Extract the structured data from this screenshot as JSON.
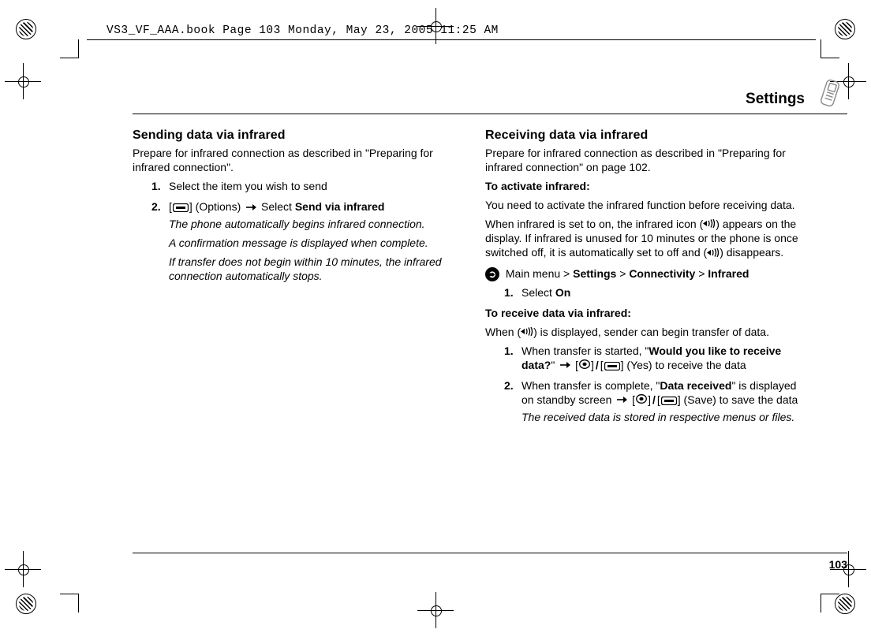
{
  "slug": "VS3_VF_AAA.book  Page 103  Monday, May 23, 2005  11:25 AM",
  "running_head": "Settings",
  "page_number": "103",
  "left": {
    "heading": "Sending data via infrared",
    "intro": "Prepare for infrared connection as described in \"Preparing for infrared connection\".",
    "step1_num": "1.",
    "step1": "Select the item you wish to send",
    "step2_num": "2.",
    "step2_pre": "[",
    "step2_mid1": "] (Options) ",
    "step2_mid2": " Select ",
    "step2_bold": "Send via infrared",
    "note1": "The phone automatically begins infrared connection.",
    "note2": "A confirmation message is displayed when complete.",
    "note3": "If transfer does not begin within 10 minutes, the infrared connection automatically stops."
  },
  "right": {
    "heading": "Receiving data via infrared",
    "intro": "Prepare for infrared connection as described in \"Preparing for infrared connection\" on page 102.",
    "activate_h": "To activate infrared:",
    "activate_p1": "You need to activate the infrared function before receiving data.",
    "activate_p2a": "When infrared is set to on, the infrared icon (",
    "activate_p2b": ") appears on the display. If infrared is unused for 10 minutes or the phone is once switched off, it is automatically set to off and (",
    "activate_p2c": ") disappears.",
    "menu_path_pre": " Main menu > ",
    "menu_settings": "Settings",
    "menu_sep": " > ",
    "menu_conn": "Connectivity",
    "menu_ir": "Infrared",
    "act_step1_num": "1.",
    "act_step1_pre": "Select ",
    "act_step1_bold": "On",
    "receive_h": "To receive data via infrared:",
    "receive_p_a": "When (",
    "receive_p_b": ") is displayed, sender can begin transfer of data.",
    "r_step1_num": "1.",
    "r_step1_a": "When transfer is started, \"",
    "r_step1_bold": "Would you like to receive data?",
    "r_step1_b": "\" ",
    "r_step1_c": " [",
    "r_step1_d": "]",
    "r_step1_e": "[",
    "r_step1_f": "] (Yes) to receive the data",
    "r_step2_num": "2.",
    "r_step2_a": "When transfer is complete, \"",
    "r_step2_bold": "Data received",
    "r_step2_b": "\" is displayed on standby screen ",
    "r_step2_c": " [",
    "r_step2_d": "]",
    "r_step2_e": "[",
    "r_step2_f": "] (Save) to save the data",
    "r_note": "The received data is stored in respective menus or files."
  }
}
